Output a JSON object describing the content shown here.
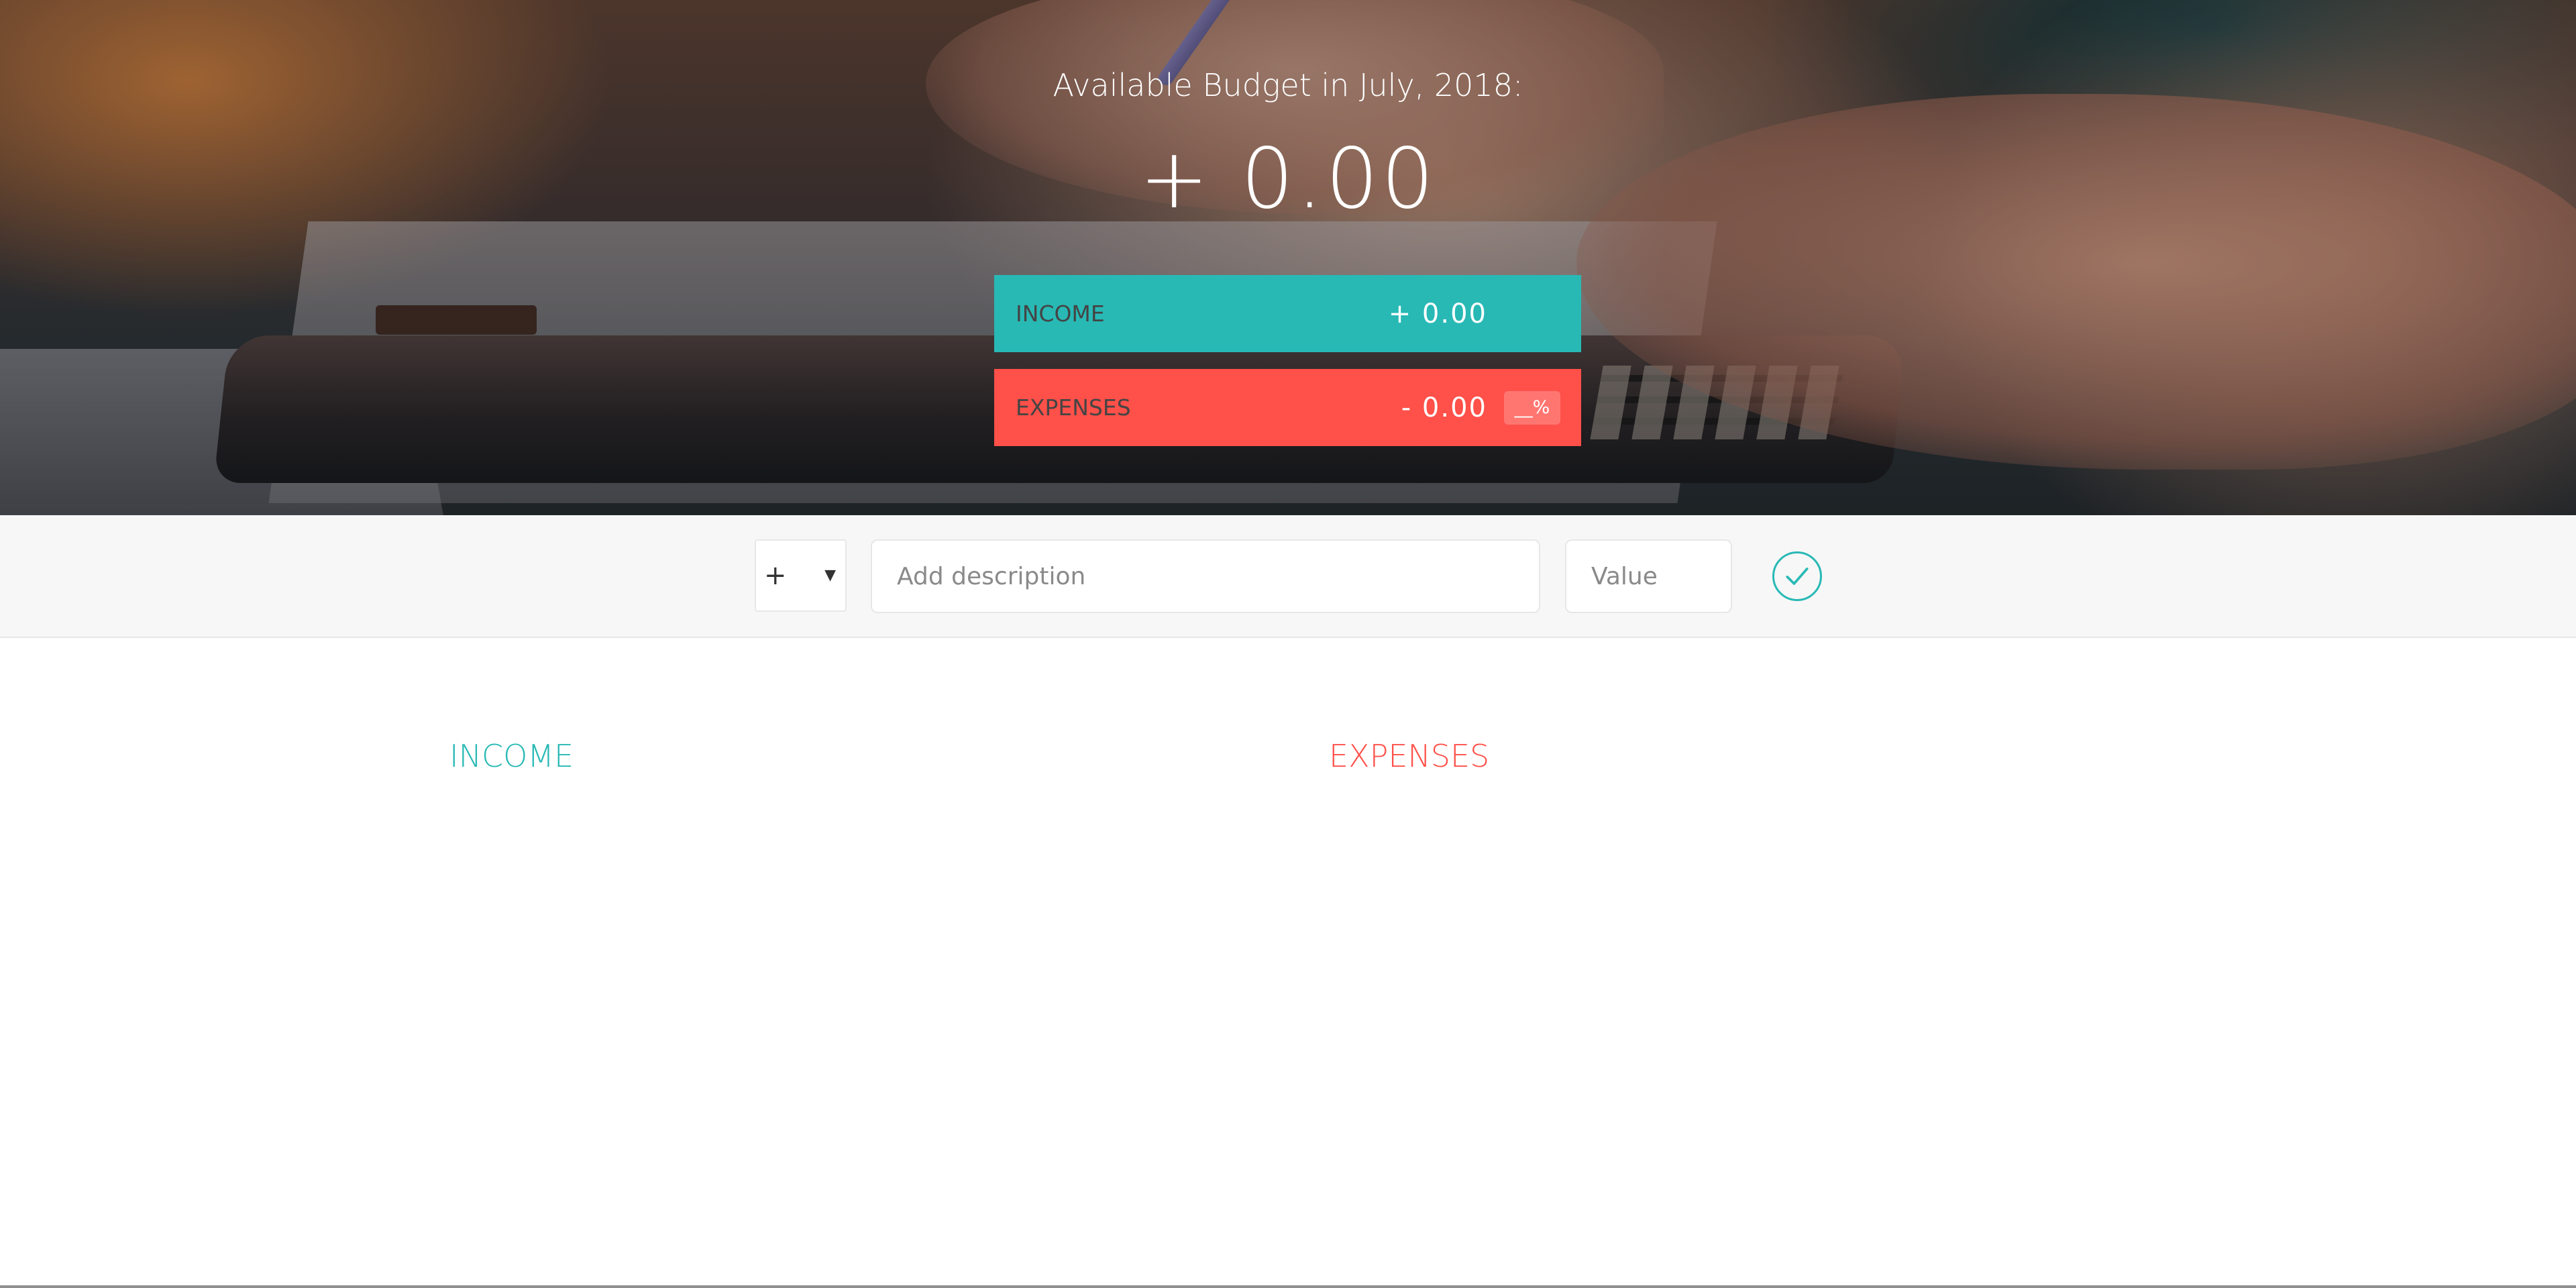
{
  "top": {
    "budget_title": "Available Budget in July, 2018:",
    "budget_value": "+ 0.00",
    "income": {
      "label": "INCOME",
      "value": "+ 0.00"
    },
    "expenses": {
      "label": "EXPENSES",
      "value": "- 0.00",
      "percentage": "__%"
    }
  },
  "add": {
    "type_value": "+",
    "type_icon": "dropdown-arrow",
    "description_placeholder": "Add description",
    "value_placeholder": "Value",
    "submit_icon": "checkmark-circle"
  },
  "lists": {
    "income_title": "INCOME",
    "expenses_title": "EXPENSES"
  },
  "colors": {
    "income": "#28b9b5",
    "expenses": "#ff5049"
  }
}
